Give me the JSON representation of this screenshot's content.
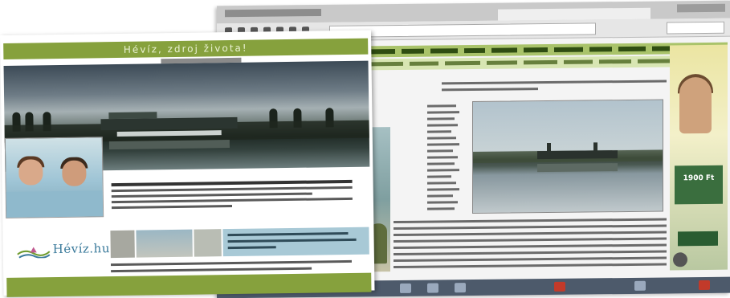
{
  "front_page": {
    "header_title": "Hévíz, zdroj života!",
    "logo": {
      "name": "Hévíz.hu"
    }
  },
  "back_window": {
    "photo_caption_price": "1900 Ft"
  }
}
